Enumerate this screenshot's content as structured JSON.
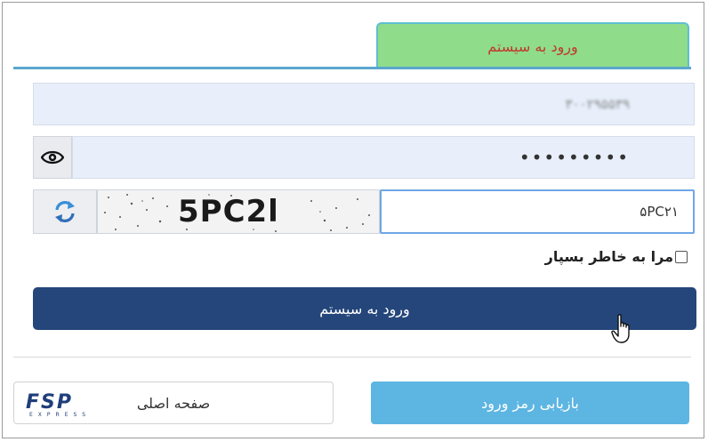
{
  "login_tab": {
    "label": "ورود به سیستم"
  },
  "username_field": {
    "value": "۳۰۰۲۹۵۵۳۹"
  },
  "password_field": {
    "value": "•••••••••"
  },
  "captcha": {
    "image_text": "5PC2l",
    "input_value": "۵PC۲۱"
  },
  "remember_me": {
    "label": "مرا به خاطر بسپار",
    "checked": false
  },
  "login_button": {
    "label": "ورود به سیستم"
  },
  "recover_password_button": {
    "label": "بازیابی رمز ورود"
  },
  "home_button": {
    "label": "صفحه اصلی"
  },
  "logo": {
    "letters": "FSP",
    "subtitle": "EXPRESS"
  },
  "colors": {
    "tab_background": "#8fdc8b",
    "tab_text": "#c0392b",
    "login_button": "#24467a",
    "recover_button": "#5db5e2",
    "field_background": "#e8effb"
  },
  "icons": {
    "eye": "eye-icon",
    "refresh": "refresh-icon",
    "cursor": "hand-pointer-icon"
  }
}
